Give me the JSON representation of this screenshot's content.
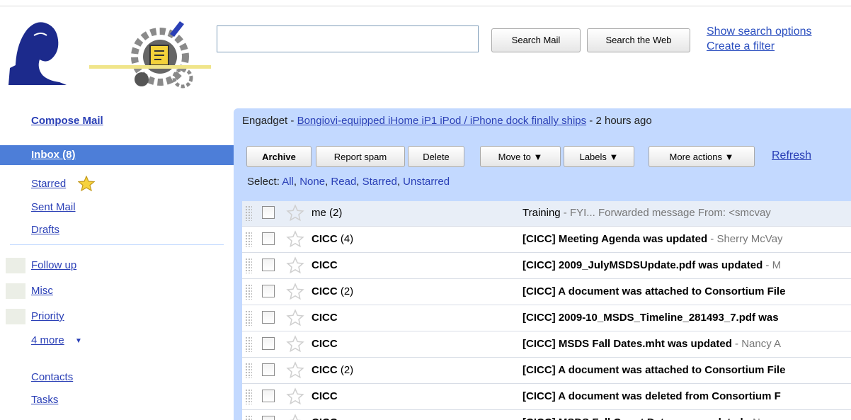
{
  "header": {
    "search_value": "",
    "search_mail_label": "Search Mail",
    "search_web_label": "Search the Web",
    "show_search_options": "Show search options",
    "create_filter": "Create a filter"
  },
  "sidebar": {
    "compose": "Compose Mail",
    "inbox": "Inbox (8)",
    "starred": "Starred",
    "sent": "Sent Mail",
    "drafts": "Drafts",
    "labels": [
      "Follow up",
      "Misc",
      "Priority"
    ],
    "more": "4 more",
    "contacts": "Contacts",
    "tasks": "Tasks"
  },
  "news": {
    "source": "Engadget - ",
    "headline": "Bongiovi-equipped iHome iP1 iPod / iPhone dock finally ships",
    "age": " - 2 hours ago"
  },
  "toolbar": {
    "archive": "Archive",
    "report_spam": "Report spam",
    "delete": "Delete",
    "move_to": "Move to",
    "labels": "Labels",
    "more_actions": "More actions",
    "refresh": "Refresh"
  },
  "select": {
    "prefix": "Select:",
    "options": [
      "All",
      "None",
      "Read",
      "Starred",
      "Unstarred"
    ]
  },
  "colors": {
    "accent": "#4d7ed8",
    "panel": "#c3d9ff",
    "link": "#2a3fb6"
  },
  "messages": [
    {
      "sender": "me",
      "count": "(2)",
      "subject": "Training",
      "snippet": " - FYI... Forwarded message From: <smcvay",
      "unread": false
    },
    {
      "sender": "CICC",
      "count": "(4)",
      "subject": "[CICC] Meeting Agenda was updated",
      "snippet": " - Sherry McVay",
      "unread": true
    },
    {
      "sender": "CICC",
      "count": "",
      "subject": "[CICC] 2009_JulyMSDSUpdate.pdf was updated",
      "snippet": " - M",
      "unread": true
    },
    {
      "sender": "CICC",
      "count": "(2)",
      "subject": "[CICC] A document was attached to Consortium File",
      "snippet": "",
      "unread": true
    },
    {
      "sender": "CICC",
      "count": "",
      "subject": "[CICC] 2009-10_MSDS_Timeline_281493_7.pdf was",
      "snippet": "",
      "unread": true
    },
    {
      "sender": "CICC",
      "count": "",
      "subject": "[CICC] MSDS Fall Dates.mht was updated",
      "snippet": " - Nancy A",
      "unread": true
    },
    {
      "sender": "CICC",
      "count": "(2)",
      "subject": "[CICC] A document was attached to Consortium File",
      "snippet": "",
      "unread": true
    },
    {
      "sender": "CICC",
      "count": "",
      "subject": "[CICC] A document was deleted from Consortium F",
      "snippet": "",
      "unread": true
    },
    {
      "sender": "CICC",
      "count": "",
      "subject": "[CICC] MSDS Fall Count Dates was updated",
      "snippet": " - Nancy",
      "unread": true
    }
  ]
}
